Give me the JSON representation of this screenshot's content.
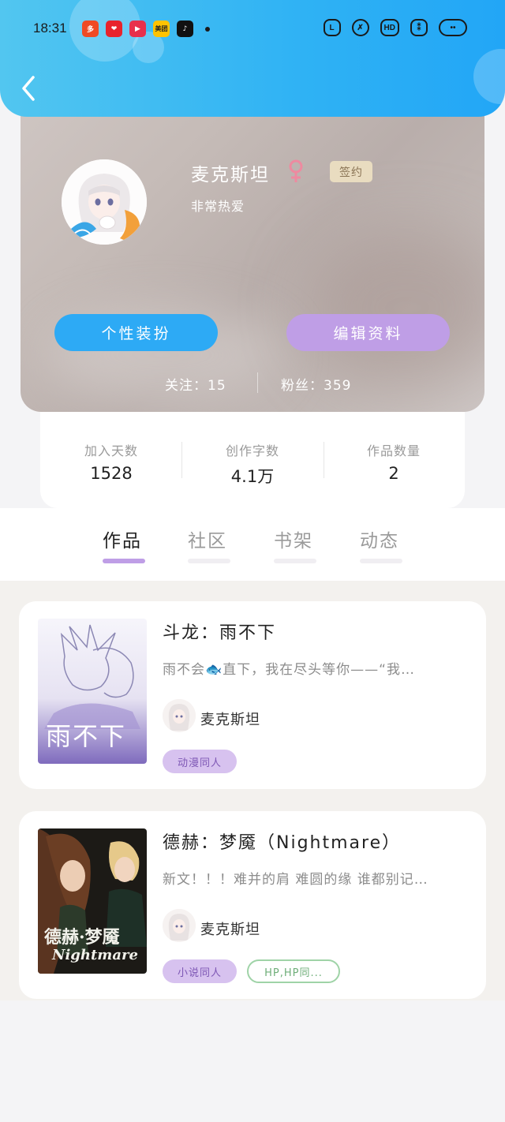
{
  "status_bar": {
    "time": "18:31",
    "app_icons": [
      {
        "name": "pinduoduo-icon",
        "color": "#f04a24",
        "glyph": "多"
      },
      {
        "name": "shop-heart-icon",
        "color": "#e8232c",
        "glyph": "❤"
      },
      {
        "name": "video-play-icon",
        "color": "#e8304c",
        "glyph": "▶"
      },
      {
        "name": "meituan-icon",
        "color": "#ffc300",
        "glyph": "美团"
      },
      {
        "name": "tiktok-icon",
        "color": "#111111",
        "glyph": "♪"
      }
    ],
    "right_icons": [
      "L",
      "✗",
      "HD",
      "⁑",
      "••"
    ]
  },
  "profile": {
    "username": "麦克斯坦",
    "gender_symbol": "♀",
    "badge": "签约",
    "bio": "非常热爱",
    "btn_style": "个性装扮",
    "btn_edit": "编辑资料",
    "follow": "关注：15",
    "fans": "粉丝：359"
  },
  "stats": [
    {
      "label": "加入天数",
      "value": "1528"
    },
    {
      "label": "创作字数",
      "value": "4.1万"
    },
    {
      "label": "作品数量",
      "value": "2"
    }
  ],
  "tabs": [
    {
      "label": "作品",
      "active": true
    },
    {
      "label": "社区",
      "active": false
    },
    {
      "label": "书架",
      "active": false
    },
    {
      "label": "动态",
      "active": false
    }
  ],
  "books": [
    {
      "title": "斗龙：雨不下",
      "desc": "雨不会🐟直下，我在尽头等你——“我…",
      "author": "麦克斯坦",
      "cover_text": "雨不下",
      "tags": [
        "动漫同人"
      ]
    },
    {
      "title": "德赫：梦魇（Nightmare）",
      "desc": "新文！！！难并的肩 难圆的缘 谁都别记…",
      "author": "麦克斯坦",
      "cover_text": "德赫·梦魇",
      "cover_text_2": "Nightmare",
      "tags": [
        "小说同人",
        "HP,HP同..."
      ]
    }
  ],
  "colors": {
    "header": "#2fb2f4",
    "accent_blue": "#2daaf5",
    "accent_purple": "#bf9ee6",
    "badge_bg": "#e9dcc0",
    "gender_pink": "#ee8aa0"
  }
}
